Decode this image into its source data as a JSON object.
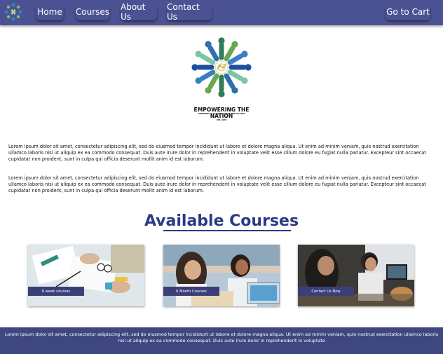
{
  "nav": {
    "links": [
      "Home",
      "Courses",
      "About Us",
      "Contact Us"
    ],
    "cart_label": "Go to Cart"
  },
  "logo": {
    "title": "EMPOWERING THE NATION",
    "tagline": "PREPARING S.A'S WORK FORCE FOR SUCCESS",
    "est": "EST. 2078"
  },
  "intro": {
    "paragraphs": [
      "Lorem ipsum dolor sit amet, consectetur adipiscing elit, sed do eiusmod tempor incididunt ut labore et dolore magna aliqua. Ut enim ad minim veniam, quis nostrud exercitation ullamco laboris nisi ut aliquip ex ea commodo consequat. Duis aute irure dolor in reprehenderit in voluptate velit esse cillum dolore eu fugiat nulla pariatur. Excepteur sint occaecat cupidatat non proident, sunt in culpa qui officia deserunt mollit anim id est laborum.",
      "Lorem ipsum dolor sit amet, consectetur adipiscing elit, sed do eiusmod tempor incididunt ut labore et dolore magna aliqua. Ut enim ad minim veniam, quis nostrud exercitation ullamco laboris nisi ut aliquip ex ea commodo consequat. Duis aute irure dolor in reprehenderit in voluptate velit esse cillum dolore eu fugiat nulla pariatur. Excepteur sint occaecat cupidatat non proident, sunt in culpa qui officia deserunt mollit anim id est laborum."
    ]
  },
  "courses": {
    "heading": "Available Courses",
    "cards": [
      {
        "label": "6 week courses"
      },
      {
        "label": "6 Month Courses"
      },
      {
        "label": "Contact Us Now"
      }
    ]
  },
  "footer": {
    "text": "Lorem ipsum dolor sit amet, consectetur adipiscing elit, sed do eiusmod tempor incididunt ut labore et dolore magna aliqua. Ut enim ad minim veniam, quis nostrud exercitation ullamco laboris nisi ut aliquip ex ea commodo consequat. Duis aute irure dolor in reprehenderit in voluptate"
  },
  "colors": {
    "nav_bg": "#4b5293",
    "heading": "#2a3a84",
    "footer_bg": "#3f4781",
    "card_label_bg": "#3a3f7a"
  }
}
